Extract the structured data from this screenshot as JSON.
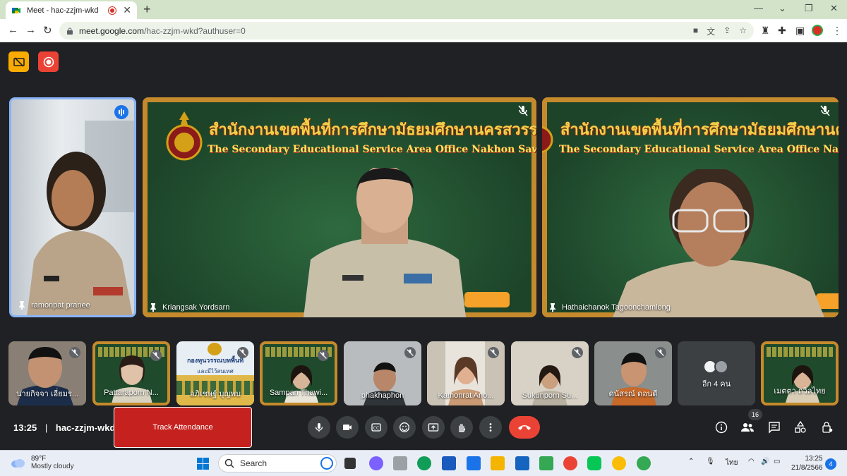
{
  "browser": {
    "tab_title": "Meet - hac-zzjm-wkd",
    "tab_close": "✕",
    "new_tab": "+",
    "url_host": "meet.google.com",
    "url_path": "/hac-zzjm-wkd?authuser=0",
    "win_min": "—",
    "win_max": "❐",
    "win_close": "✕"
  },
  "board": {
    "title_th": "สำนักงานเขตพื้นที่การศึกษามัธยมศึกษานครสวรรค์",
    "title_en": "The Secondary Educational Service Area Office Nakhon Sawan"
  },
  "main_tiles": [
    {
      "name": "ramonpat pranee"
    },
    {
      "name": "Kriangsak Yordsarn"
    },
    {
      "name": "Hathaichanok Tagoonchamlong"
    }
  ],
  "small_tiles": [
    {
      "name": "นายกิจจา เอี่ยมร..."
    },
    {
      "name": "Pattaraporn N..."
    },
    {
      "name": "อภิเชษฐ์ บุญพบ",
      "poster_title": "กองทุนวรรณบทพื้นที่",
      "poster_sub": "และมีไว้สนเทศ"
    },
    {
      "name": "Sampan Thawi..."
    },
    {
      "name": "phakhaphon"
    },
    {
      "name": "Kamonrat Ano..."
    },
    {
      "name": "Sukunporn Su..."
    },
    {
      "name": "ดนัสรณ์ ดอนดี"
    },
    {
      "name": "อีก 4 คน"
    },
    {
      "name": "เมตตา ถวิลไทย"
    }
  ],
  "bottom": {
    "time": "13:25",
    "separator": "|",
    "meeting_code": "hac-zzjm-wkd",
    "track_label": "Track Attendance",
    "people_count": "16"
  },
  "taskbar": {
    "temp": "89°F",
    "weather": "Mostly cloudy",
    "search_label": "Search",
    "lang": "ไทย",
    "clock_time": "13:25",
    "clock_date": "21/8/2566",
    "notif_count": "4"
  },
  "colors": {
    "meet_bg": "#202124",
    "active_border": "#8ab4f8",
    "hangup": "#ea4335",
    "track": "#c5221f",
    "yellow_btn": "#f9ab00",
    "rec_btn": "#ea4335",
    "board_frame": "#c58a2c",
    "board_green": "#1f4a2c"
  }
}
